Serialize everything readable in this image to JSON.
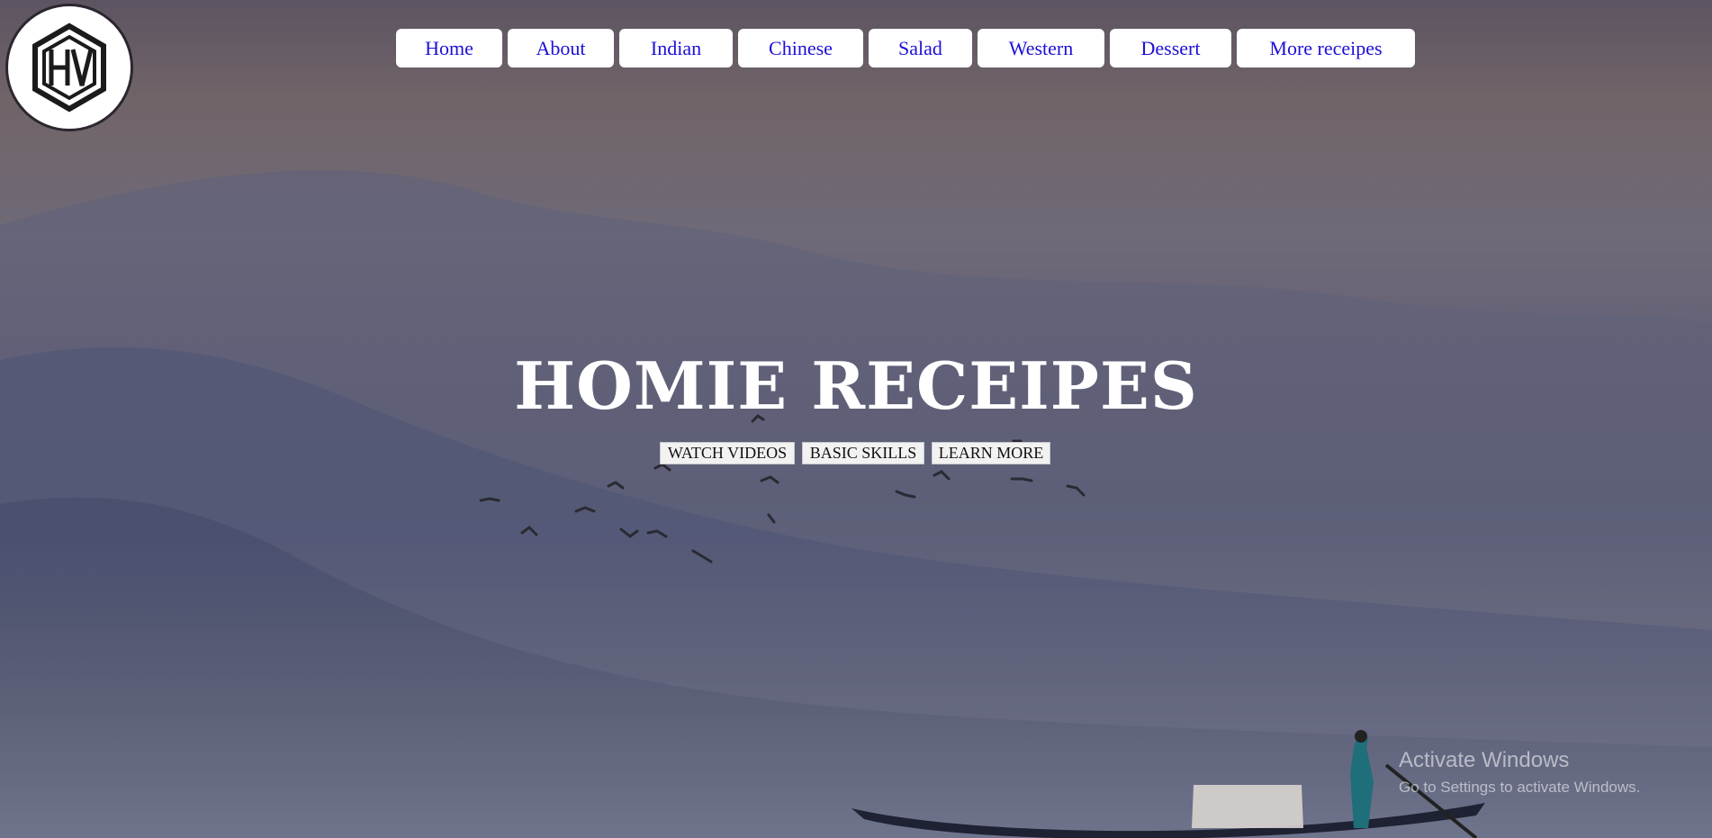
{
  "logo": {
    "name": "hv-logo"
  },
  "nav": {
    "items": [
      {
        "label": "Home"
      },
      {
        "label": "About"
      },
      {
        "label": "Indian"
      },
      {
        "label": "Chinese"
      },
      {
        "label": "Salad"
      },
      {
        "label": "Western"
      },
      {
        "label": "Dessert"
      },
      {
        "label": "More receipes"
      }
    ],
    "link_color": "#1d10d8"
  },
  "hero": {
    "title": "HOMIE RECEIPES",
    "buttons": [
      {
        "label": "WATCH VIDEOS"
      },
      {
        "label": "BASIC SKILLS"
      },
      {
        "label": "LEARN MORE"
      }
    ]
  },
  "watermark": {
    "title": "Activate Windows",
    "subtitle": "Go to Settings to activate Windows."
  }
}
